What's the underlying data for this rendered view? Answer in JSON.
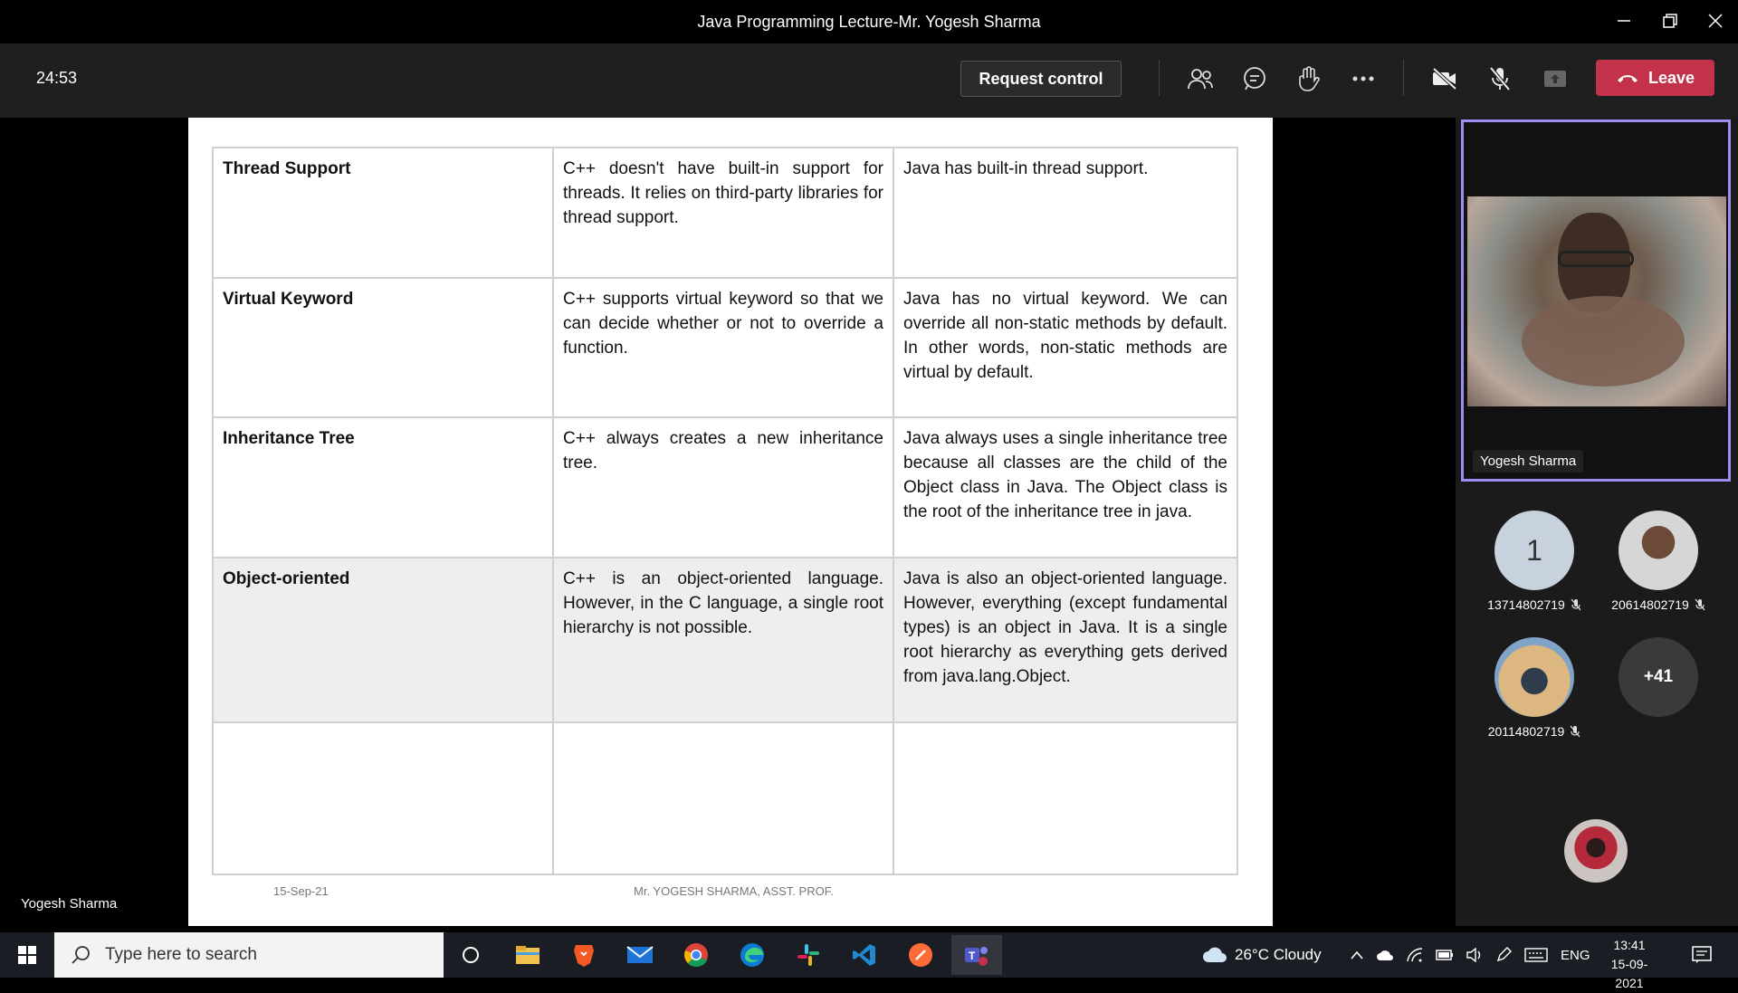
{
  "window": {
    "title": "Java Programming Lecture-Mr. Yogesh Sharma",
    "minimize_icon": "minimize-icon",
    "restore_icon": "restore-icon",
    "close_icon": "close-icon"
  },
  "meeting_toolbar": {
    "timer": "24:53",
    "request_control_label": "Request control",
    "leave_label": "Leave",
    "leave_color": "#c4314b",
    "icons": [
      "participants-icon",
      "chat-icon",
      "raise-hand-icon",
      "more-icon",
      "camera-off-icon",
      "mic-off-icon",
      "share-tray-icon",
      "hangup-icon"
    ]
  },
  "slide": {
    "rows": [
      {
        "feature": "Thread Support",
        "cpp": "C++ doesn't have built-in support for threads. It relies on third-party libraries for thread support.",
        "java": "Java has built-in thread support."
      },
      {
        "feature": "Virtual Keyword",
        "cpp": "C++ supports virtual keyword so that we can decide whether or not to override a function.",
        "java": "Java has no virtual keyword. We can override all non-static methods by default. In other words, non-static methods are virtual by default."
      },
      {
        "feature": "Inheritance Tree",
        "cpp": "C++ always creates a new inheritance tree.",
        "java": "Java always uses a single inheritance tree because all classes are the child of the Object class in Java. The Object class is the root of the inheritance tree in java."
      },
      {
        "feature": "Object-oriented",
        "cpp": "C++ is an object-oriented language. However, in the C language, a single root hierarchy is not possible.",
        "java": "Java is also an object-oriented language. However, everything (except fundamental types) is an object in Java. It is a single root hierarchy as everything gets derived from java.lang.Object."
      }
    ],
    "footer_date": "15-Sep-21",
    "footer_name": "Mr. YOGESH SHARMA, ASST. PROF."
  },
  "stage": {
    "presenter_name": "Yogesh Sharma"
  },
  "participants_panel": {
    "video_name": "Yogesh Sharma",
    "highlight_color": "#9b8df2",
    "participants": [
      {
        "avatar": "1",
        "name": "13714802719",
        "muted_icon": "mic-off-icon"
      },
      {
        "avatar": "",
        "name": "20614802719",
        "muted_icon": "mic-off-icon"
      },
      {
        "avatar": "",
        "name": "20114802719",
        "muted_icon": "mic-off-icon"
      },
      {
        "avatar": "+41",
        "name": "",
        "muted_icon": ""
      }
    ]
  },
  "taskbar": {
    "search_placeholder": "Type here to search",
    "weather": "26°C  Cloudy",
    "language": "ENG",
    "time": "13:41",
    "date": "15-09-2021",
    "apps": [
      "start-icon",
      "cortana-icon",
      "file-explorer-icon",
      "brave-browser-icon",
      "mail-icon",
      "chrome-icon",
      "edge-icon",
      "slack-icon",
      "vscode-icon",
      "postman-icon",
      "teams-icon"
    ]
  }
}
